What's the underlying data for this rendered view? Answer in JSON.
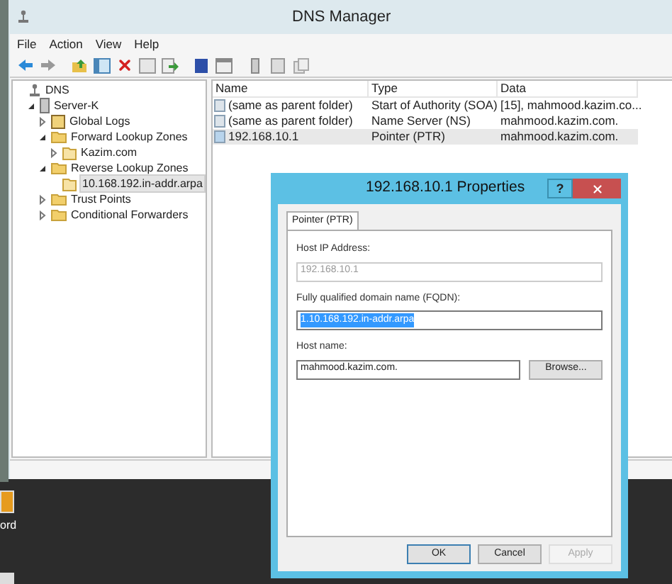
{
  "window": {
    "title": "DNS Manager"
  },
  "menu": [
    "File",
    "Action",
    "View",
    "Help"
  ],
  "tree": [
    {
      "label": "DNS",
      "kind": "dns",
      "selected": false,
      "children": [
        {
          "label": "Server-K",
          "kind": "server",
          "expanded": true,
          "selected": false,
          "children": [
            {
              "label": "Global Logs",
              "kind": "logs",
              "expanded": false,
              "selected": false
            },
            {
              "label": "Forward Lookup Zones",
              "kind": "folder",
              "expanded": true,
              "selected": false,
              "children": [
                {
                  "label": "Kazim.com",
                  "kind": "zone",
                  "expanded": false,
                  "selected": false
                }
              ]
            },
            {
              "label": "Reverse Lookup Zones",
              "kind": "folder",
              "expanded": true,
              "selected": false,
              "children": [
                {
                  "label": "10.168.192.in-addr.arpa",
                  "kind": "zone",
                  "selected": true
                }
              ]
            },
            {
              "label": "Trust Points",
              "kind": "folder",
              "expanded": false,
              "selected": false
            },
            {
              "label": "Conditional Forwarders",
              "kind": "folder",
              "expanded": false,
              "selected": false
            }
          ]
        }
      ]
    }
  ],
  "table": {
    "columns": [
      "Name",
      "Type",
      "Data"
    ],
    "rows": [
      {
        "name": "(same as parent folder)",
        "type": "Start of Authority (SOA)",
        "data": "[15], mahmood.kazim.co...",
        "selected": false
      },
      {
        "name": "(same as parent folder)",
        "type": "Name Server (NS)",
        "data": "mahmood.kazim.com.",
        "selected": false
      },
      {
        "name": "192.168.10.1",
        "type": "Pointer (PTR)",
        "data": "mahmood.kazim.com.",
        "selected": true
      }
    ]
  },
  "dialog": {
    "title": "192.168.10.1 Properties",
    "help": "?",
    "tabs": [
      {
        "label": "Pointer (PTR)",
        "selected": true
      }
    ],
    "fields": [
      {
        "label": "Host IP Address:",
        "value": "192.168.10.1",
        "disabled": true,
        "highlighted": false
      },
      {
        "label": "Fully qualified domain name (FQDN):",
        "value": "1.10.168.192.in-addr.arpa",
        "disabled": false,
        "highlighted": true
      },
      {
        "label": "Host name:",
        "value": "mahmood.kazim.com.",
        "disabled": false,
        "highlighted": false,
        "button": "Browse..."
      }
    ],
    "buttons": [
      {
        "label": "OK",
        "disabled": false,
        "default": true
      },
      {
        "label": "Cancel",
        "disabled": false,
        "default": false
      },
      {
        "label": "Apply",
        "disabled": true,
        "default": false
      }
    ]
  },
  "desktop_icons": [
    {
      "label": "ord"
    }
  ]
}
